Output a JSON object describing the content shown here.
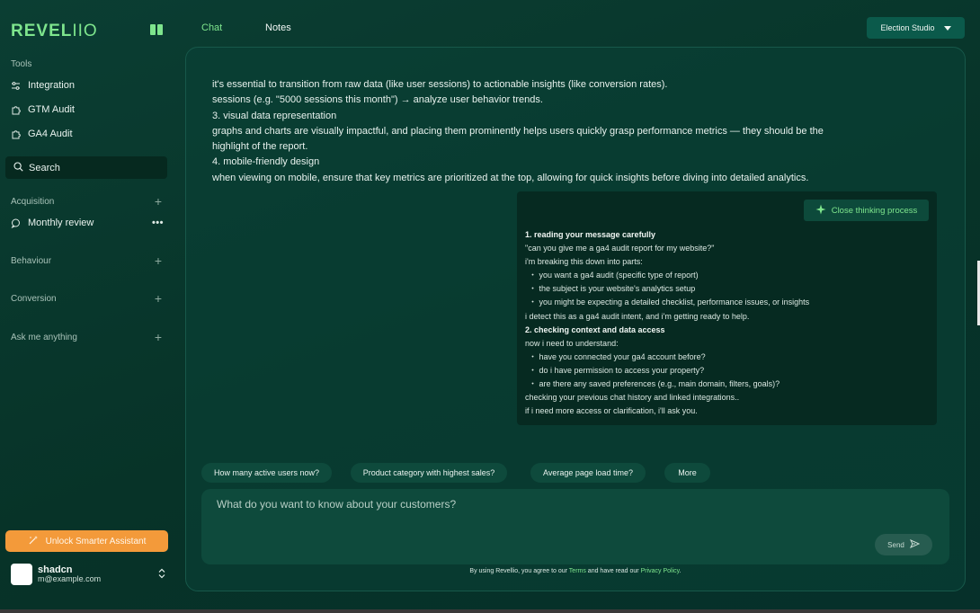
{
  "brand": {
    "logo_bold": "REVEL",
    "logo_thin": "IIO"
  },
  "sidebar": {
    "tools_label": "Tools",
    "tools": [
      {
        "label": "Integration",
        "icon": "sliders-icon"
      },
      {
        "label": "GTM Audit",
        "icon": "puzzle-icon"
      },
      {
        "label": "GA4 Audit",
        "icon": "puzzle-icon"
      }
    ],
    "search_label": "Search",
    "groups": [
      {
        "label": "Acquisition",
        "items": [
          {
            "label": "Monthly review"
          }
        ]
      },
      {
        "label": "Behaviour",
        "items": []
      },
      {
        "label": "Conversion",
        "items": []
      },
      {
        "label": "Ask me anything",
        "items": []
      }
    ],
    "unlock_label": "Unlock Smarter Assistant",
    "user": {
      "name": "shadcn",
      "email": "m@example.com"
    }
  },
  "header": {
    "tabs": [
      {
        "label": "Chat",
        "active": true
      },
      {
        "label": "Notes",
        "active": false
      }
    ],
    "studio_label": "Election Studio"
  },
  "chat": {
    "response_lines": [
      "it's essential to transition from raw data (like user sessions) to actionable insights (like conversion rates).",
      "sessions (e.g. \"5000 sessions this month\") → analyze user behavior trends.",
      "3. visual data representation",
      "graphs and charts are visually impactful, and placing them prominently helps users quickly grasp performance metrics — they should be the",
      "highlight of the report.",
      "4. mobile-friendly design",
      "when viewing on mobile, ensure that key metrics are prioritized at the top, allowing for quick insights before diving into detailed analytics."
    ],
    "thinking": {
      "close_label": "Close thinking process",
      "sections": [
        {
          "heading": "1. reading your message carefully",
          "lines": [
            {
              "text": "\"can you give me a ga4 audit report for my website?\"",
              "bullet": false
            },
            {
              "text": "i'm breaking this down into parts:",
              "bullet": false
            },
            {
              "text": "・ you want a ga4 audit (specific type of report)",
              "bullet": true
            },
            {
              "text": "・ the subject is your website's analytics setup",
              "bullet": true
            },
            {
              "text": "・ you might be expecting a detailed checklist, performance issues, or insights",
              "bullet": true
            },
            {
              "text": "i detect this as a ga4 audit intent, and i'm getting ready to help.",
              "bullet": false
            }
          ]
        },
        {
          "heading": "2. checking context and data access",
          "lines": [
            {
              "text": "now i need to understand:",
              "bullet": false
            },
            {
              "text": "・ have you connected your ga4 account before?",
              "bullet": true
            },
            {
              "text": "・ do i have permission to access your property?",
              "bullet": true
            },
            {
              "text": "・ are there any saved preferences (e.g., main domain, filters, goals)?",
              "bullet": true
            },
            {
              "text": "checking your previous chat history and linked integrations..",
              "bullet": false
            },
            {
              "text": "if i need more access or clarification, i'll ask you.",
              "bullet": false
            }
          ]
        }
      ]
    },
    "suggestions": [
      "How many active users now?",
      "Product category with highest sales?",
      "Average page load time?",
      "More"
    ],
    "composer": {
      "placeholder": "What do you want to know about your customers?",
      "send_label": "Send"
    },
    "disclaimer": {
      "prefix": "By using Revellio, you agree to our ",
      "terms": "Terms",
      "middle": " and have read our ",
      "privacy": "Privacy Policy",
      "suffix": "."
    }
  },
  "colors": {
    "accent": "#7ee58d",
    "unlock": "#f39a3a",
    "panel": "#062a21",
    "studio": "#0b5a4b"
  }
}
